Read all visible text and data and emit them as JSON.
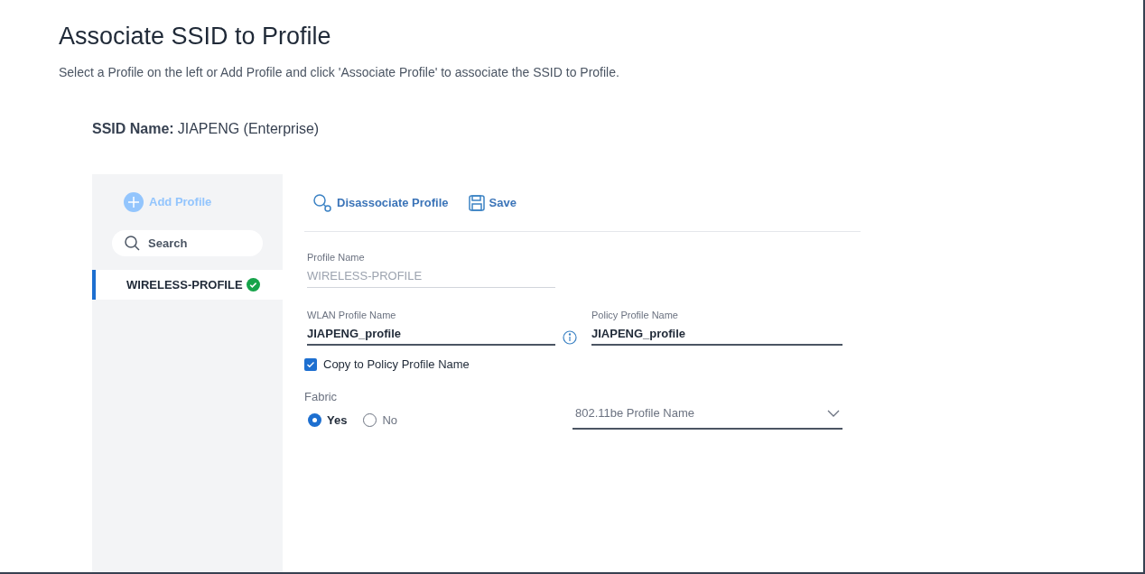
{
  "page": {
    "title": "Associate SSID to Profile",
    "description": "Select a Profile on the left or Add Profile and click 'Associate Profile' to associate the SSID to Profile."
  },
  "ssid": {
    "label": "SSID Name:",
    "value": "JIAPENG (Enterprise)"
  },
  "sidebar": {
    "add_button": {
      "label": "Add Profile",
      "disabled": true
    },
    "search": {
      "placeholder": "Search"
    },
    "profiles": [
      {
        "name": "WIRELESS-PROFILE",
        "selected": true,
        "associated": true
      }
    ]
  },
  "toolbar": [
    {
      "kind": "disassociate",
      "label": "Disassociate Profile"
    },
    {
      "kind": "save",
      "label": "Save"
    }
  ],
  "form": {
    "profile_name": {
      "label": "Profile Name",
      "value": "WIRELESS-PROFILE",
      "disabled": true
    },
    "wlan_profile_name": {
      "label": "WLAN Profile Name",
      "value": "JIAPENG_profile",
      "disabled": false
    },
    "policy_profile_name": {
      "label": "Policy Profile Name",
      "value": "JIAPENG_profile",
      "disabled": false
    },
    "copy_checkbox": {
      "label": "Copy to Policy Profile Name",
      "checked": true
    },
    "fabric": {
      "label": "Fabric",
      "options": [
        {
          "label": "Yes",
          "selected": true
        },
        {
          "label": "No",
          "selected": false
        }
      ]
    },
    "profile_select": {
      "placeholder": "802.11be Profile Name"
    }
  }
}
